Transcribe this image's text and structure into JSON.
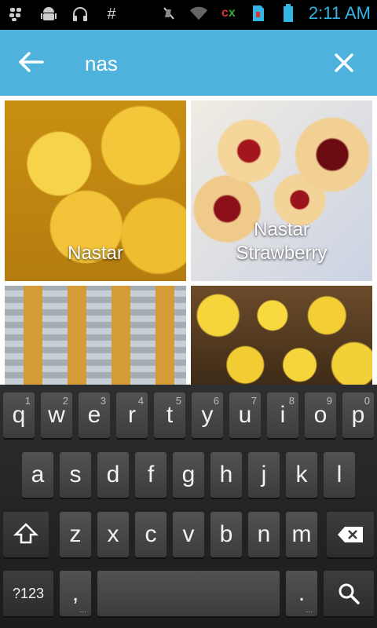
{
  "status_bar": {
    "icons": [
      "bbm-icon",
      "android-icon",
      "headset-icon",
      "hash-icon",
      "mute-icon",
      "wifi-icon",
      "cx-icon",
      "sim-icon",
      "battery-icon"
    ],
    "cx_c": "c",
    "cx_x": "x",
    "time": "2:11 AM"
  },
  "search": {
    "query": "nas"
  },
  "results": [
    {
      "label": "Nastar"
    },
    {
      "label": "Nastar\nStrawberry"
    },
    {
      "label": ""
    },
    {
      "label": ""
    }
  ],
  "keyboard": {
    "row1": [
      {
        "k": "q",
        "h": "1"
      },
      {
        "k": "w",
        "h": "2"
      },
      {
        "k": "e",
        "h": "3"
      },
      {
        "k": "r",
        "h": "4"
      },
      {
        "k": "t",
        "h": "5"
      },
      {
        "k": "y",
        "h": "6"
      },
      {
        "k": "u",
        "h": "7"
      },
      {
        "k": "i",
        "h": "8"
      },
      {
        "k": "o",
        "h": "9"
      },
      {
        "k": "p",
        "h": "0"
      }
    ],
    "row2": [
      "a",
      "s",
      "d",
      "f",
      "g",
      "h",
      "j",
      "k",
      "l"
    ],
    "row3": [
      "z",
      "x",
      "c",
      "v",
      "b",
      "n",
      "m"
    ],
    "symbols_label": "?123",
    "comma": ",",
    "period": "."
  }
}
